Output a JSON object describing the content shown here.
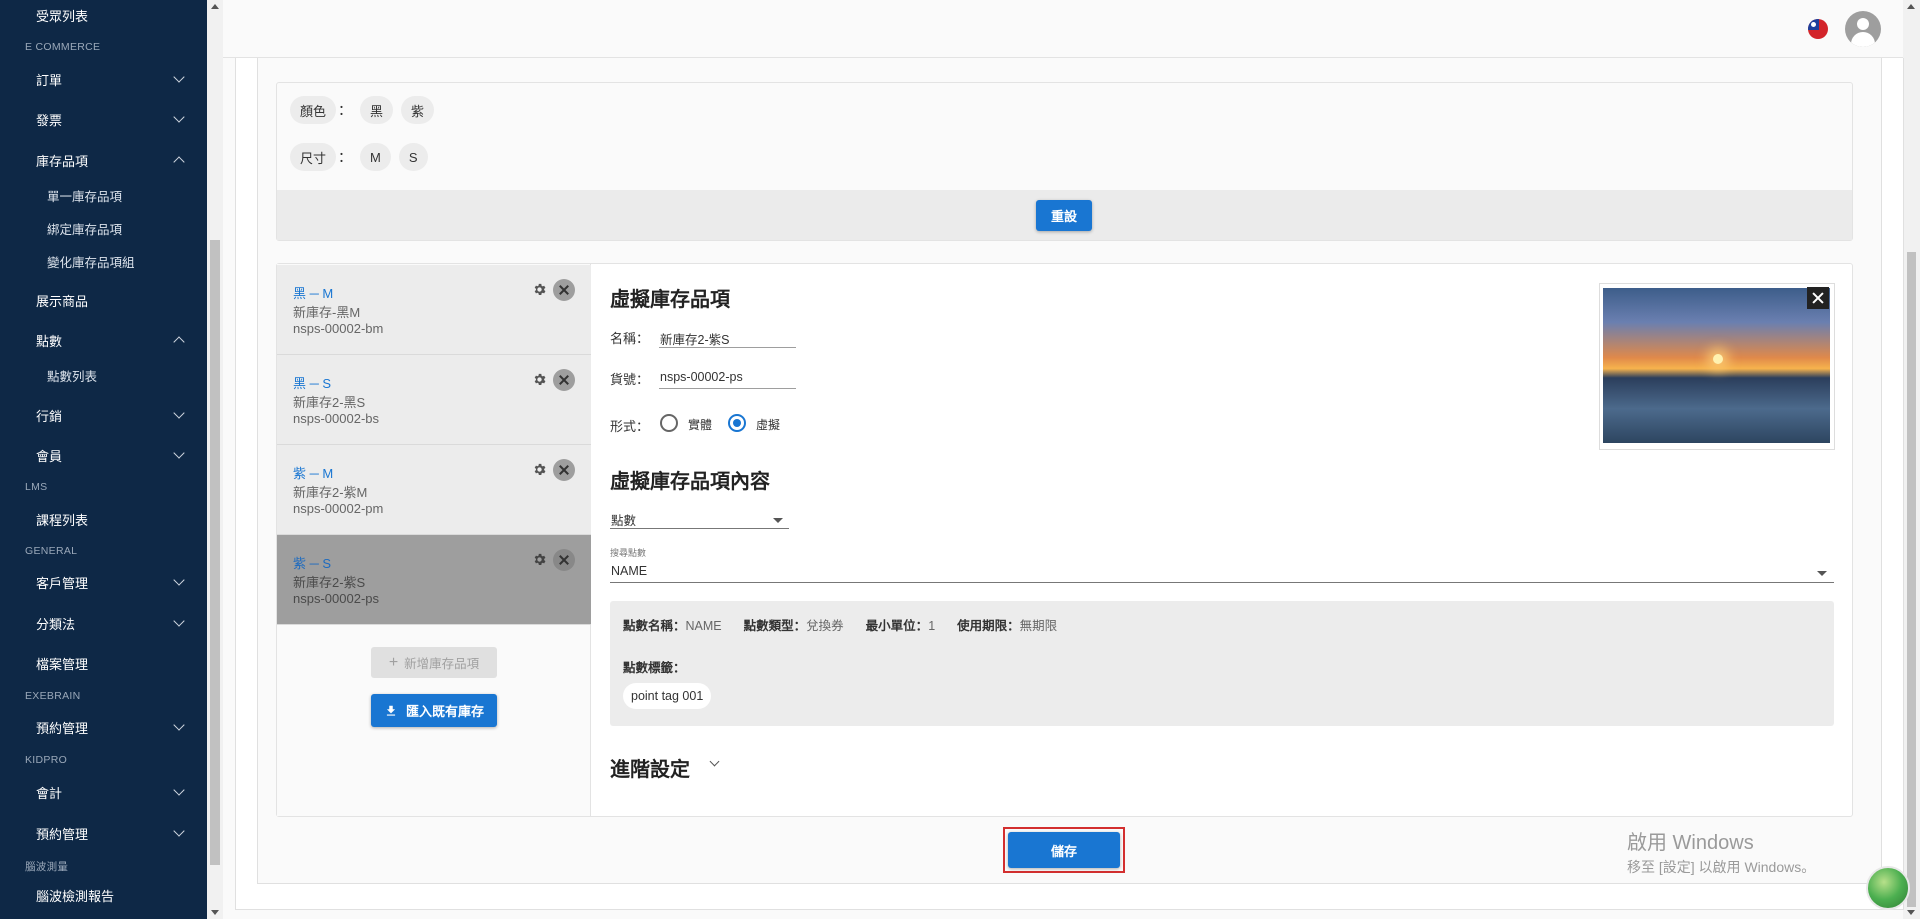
{
  "sidebar": {
    "top_item": "受眾列表",
    "sections": {
      "ecommerce": "E COMMERCE",
      "lms": "LMS",
      "general": "GENERAL",
      "exebrain": "EXEBRAIN",
      "kidpro": "KIDPRO",
      "brainwave": "腦波測量"
    },
    "items": {
      "orders": "訂單",
      "invoices": "發票",
      "inventory": "庫存品項",
      "inventory_single": "單一庫存品項",
      "inventory_bundle": "綁定庫存品項",
      "inventory_variant": "變化庫存品項組",
      "showcase": "展示商品",
      "points": "點數",
      "points_list": "點數列表",
      "marketing": "行銷",
      "members": "會員",
      "courses": "課程列表",
      "customers": "客戶管理",
      "taxonomy": "分類法",
      "files": "檔案管理",
      "booking1": "預約管理",
      "accounting": "會計",
      "booking2": "預約管理",
      "brainwave_report": "腦波檢測報告"
    }
  },
  "options": {
    "color_label": "顏色",
    "colors": [
      "黑",
      "紫"
    ],
    "size_label": "尺寸",
    "sizes": [
      "M",
      "S"
    ],
    "colon": "：",
    "reset": "重設"
  },
  "variants": [
    {
      "title": "黑 ─ M",
      "name": "新庫存-黑M",
      "sku": "nsps-00002-bm"
    },
    {
      "title": "黑 ─ S",
      "name": "新庫存2-黑S",
      "sku": "nsps-00002-bs"
    },
    {
      "title": "紫 ─ M",
      "name": "新庫存2-紫M",
      "sku": "nsps-00002-pm"
    },
    {
      "title": "紫 ─ S",
      "name": "新庫存2-紫S",
      "sku": "nsps-00002-ps"
    }
  ],
  "buttons": {
    "add": "新增庫存品項",
    "import": "匯入既有庫存",
    "save": "儲存"
  },
  "detail": {
    "title": "虛擬庫存品項",
    "name_label": "名稱：",
    "name_value": "新庫存2-紫S",
    "sku_label": "貨號：",
    "sku_value": "nsps-00002-ps",
    "type_label": "形式：",
    "type_physical": "實體",
    "type_virtual": "虛擬",
    "selected_type": "虛擬",
    "content_title": "虛擬庫存品項內容",
    "content_select": "點數",
    "search_label": "搜尋點數",
    "search_value": "NAME",
    "info": {
      "name_label": "點數名稱：",
      "name_value": "NAME",
      "type_label": "點數類型：",
      "type_value": "兌換券",
      "unit_label": "最小單位：",
      "unit_value": "1",
      "expiry_label": "使用期限：",
      "expiry_value": "無期限",
      "tag_label": "點數標籤：",
      "tag_value": "point tag 001"
    },
    "advanced": "進階設定"
  },
  "watermark": {
    "line1": "啟用 Windows",
    "line2": "移至 [設定] 以啟用 Windows。"
  },
  "colors": {
    "sidebar_bg": "#0e2846",
    "primary": "#1976d2",
    "highlight": "#d32f2f"
  }
}
